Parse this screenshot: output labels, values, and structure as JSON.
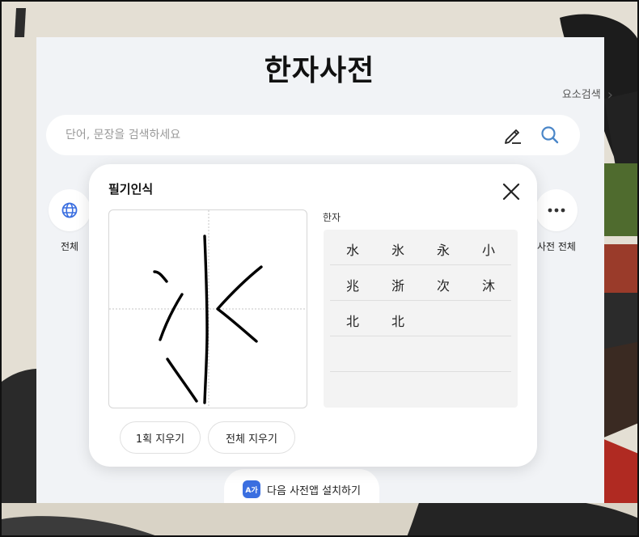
{
  "page": {
    "title": "한자사전"
  },
  "links": {
    "element_search": "요소검색",
    "chevron": "›"
  },
  "search": {
    "placeholder": "단어, 문장을 검색하세요",
    "value": ""
  },
  "categories": {
    "left": {
      "label": "전체",
      "icon": "globe-icon"
    },
    "right": {
      "label": "사전 전체",
      "icon": "more-dots-icon"
    }
  },
  "handwriting": {
    "title": "필기인식",
    "candidates_label": "한자",
    "candidates": [
      [
        "水",
        "氷",
        "永",
        "小"
      ],
      [
        "兆",
        "浙",
        "次",
        "沐"
      ],
      [
        "北",
        "北"
      ]
    ],
    "undo_label": "1획 지우기",
    "clear_label": "전체 지우기"
  },
  "install": {
    "label": "다음 사전앱 설치하기",
    "icon_text": "A가"
  },
  "colors": {
    "accent": "#3b6fe0",
    "search_icon": "#4a86c8",
    "panel_bg": "#f1f3f6"
  }
}
